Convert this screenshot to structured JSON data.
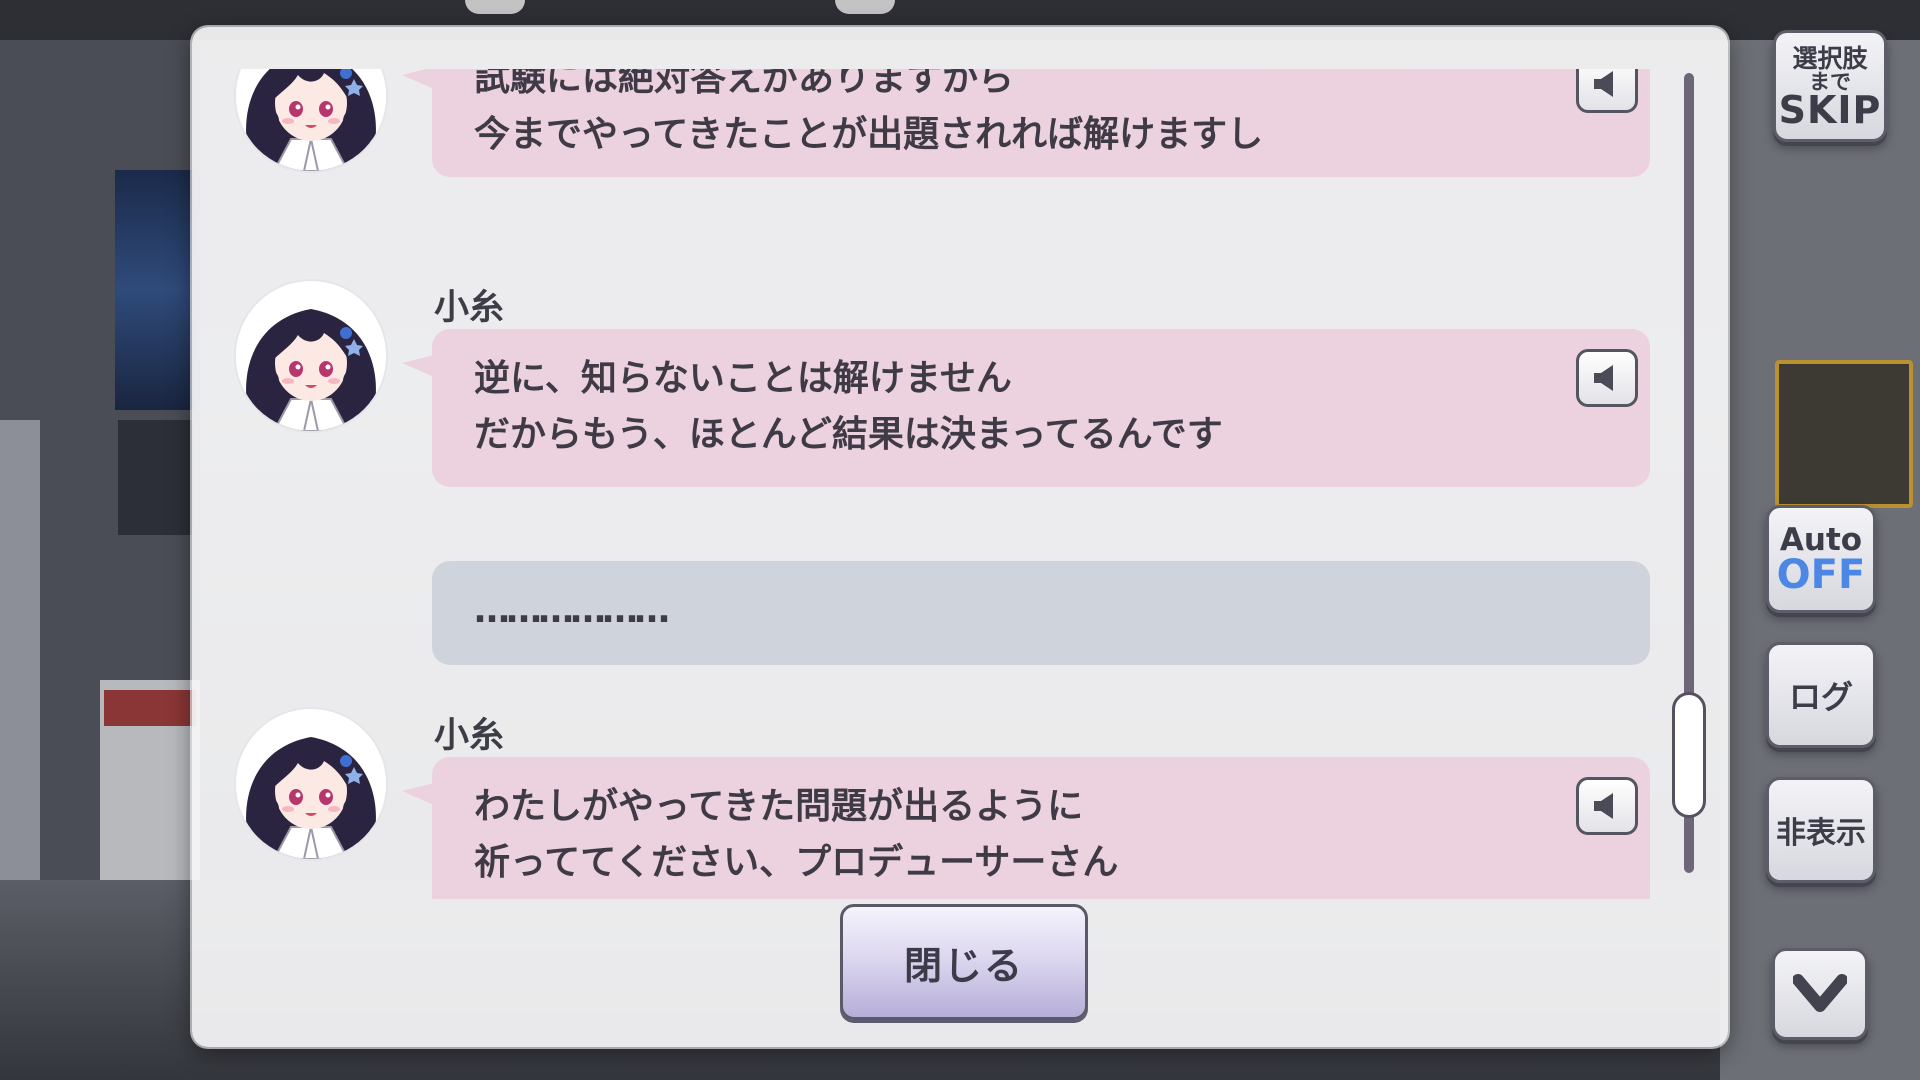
{
  "buttons": {
    "skip_line1": "選択肢",
    "skip_line2": "まで",
    "skip_line3": "SKIP",
    "auto_label": "Auto",
    "auto_value": "OFF",
    "log_label": "ログ",
    "hide_label": "非表示"
  },
  "log": {
    "entries": [
      {
        "speaker": "",
        "lines": [
          "試験には絶対答えがありますから",
          "今までやってきたことが出題されれば解けますし"
        ]
      },
      {
        "speaker": "小糸",
        "lines": [
          "逆に、知らないことは解けません",
          "だからもう、ほとんど結果は決まってるんです"
        ]
      },
      {
        "speaker": "",
        "lines": [
          "………………"
        ]
      },
      {
        "speaker": "小糸",
        "lines": [
          "わたしがやってきた問題が出るように",
          "祈っててください、プロデューサーさん"
        ]
      }
    ],
    "close_label": "閉じる"
  },
  "colors": {
    "bubble_pink": "#ecd1df",
    "bubble_grey": "#cfd3db",
    "auto_off": "#4c87e6",
    "hair": "#2a2440"
  }
}
